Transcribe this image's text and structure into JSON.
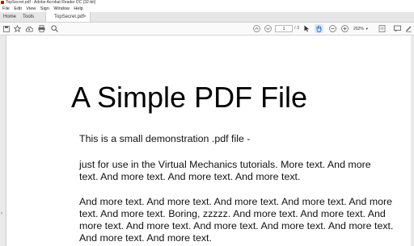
{
  "window": {
    "title": "TopSecret.pdf - Adobe Acrobat Reader DC (32-bit)"
  },
  "menu": [
    "File",
    "Edit",
    "View",
    "Sign",
    "Window",
    "Help"
  ],
  "tabs": {
    "home": "Home",
    "tools": "Tools",
    "document": "TopSecret.pdf",
    "close": "×"
  },
  "toolbar": {
    "page_current": "1",
    "page_total": "/ 3",
    "zoom": "202%"
  },
  "document": {
    "title": "A Simple PDF File",
    "paragraphs": [
      "This is a small demonstration .pdf file -",
      "just for use in the Virtual Mechanics tutorials. More text. And more\ntext. And more text. And more text. And more text.",
      "And more text. And more text. And more text. And more text. And more\ntext. And more text. Boring, zzzzz. And more text. And more text. And\nmore text. And more text. And more text. And more text. And more text.\nAnd more text. And more text."
    ]
  },
  "icons": [
    "app-icon",
    "save-icon",
    "bookmark-star-icon",
    "upload-cloud-icon",
    "print-icon",
    "search-icon",
    "page-up-icon",
    "page-down-icon",
    "select-cursor-icon",
    "hand-tool-icon",
    "zoom-out-icon",
    "zoom-in-icon",
    "fit-page-icon",
    "comment-icon",
    "sign-icon",
    "share-icon",
    "collapse-arrow-icon"
  ]
}
